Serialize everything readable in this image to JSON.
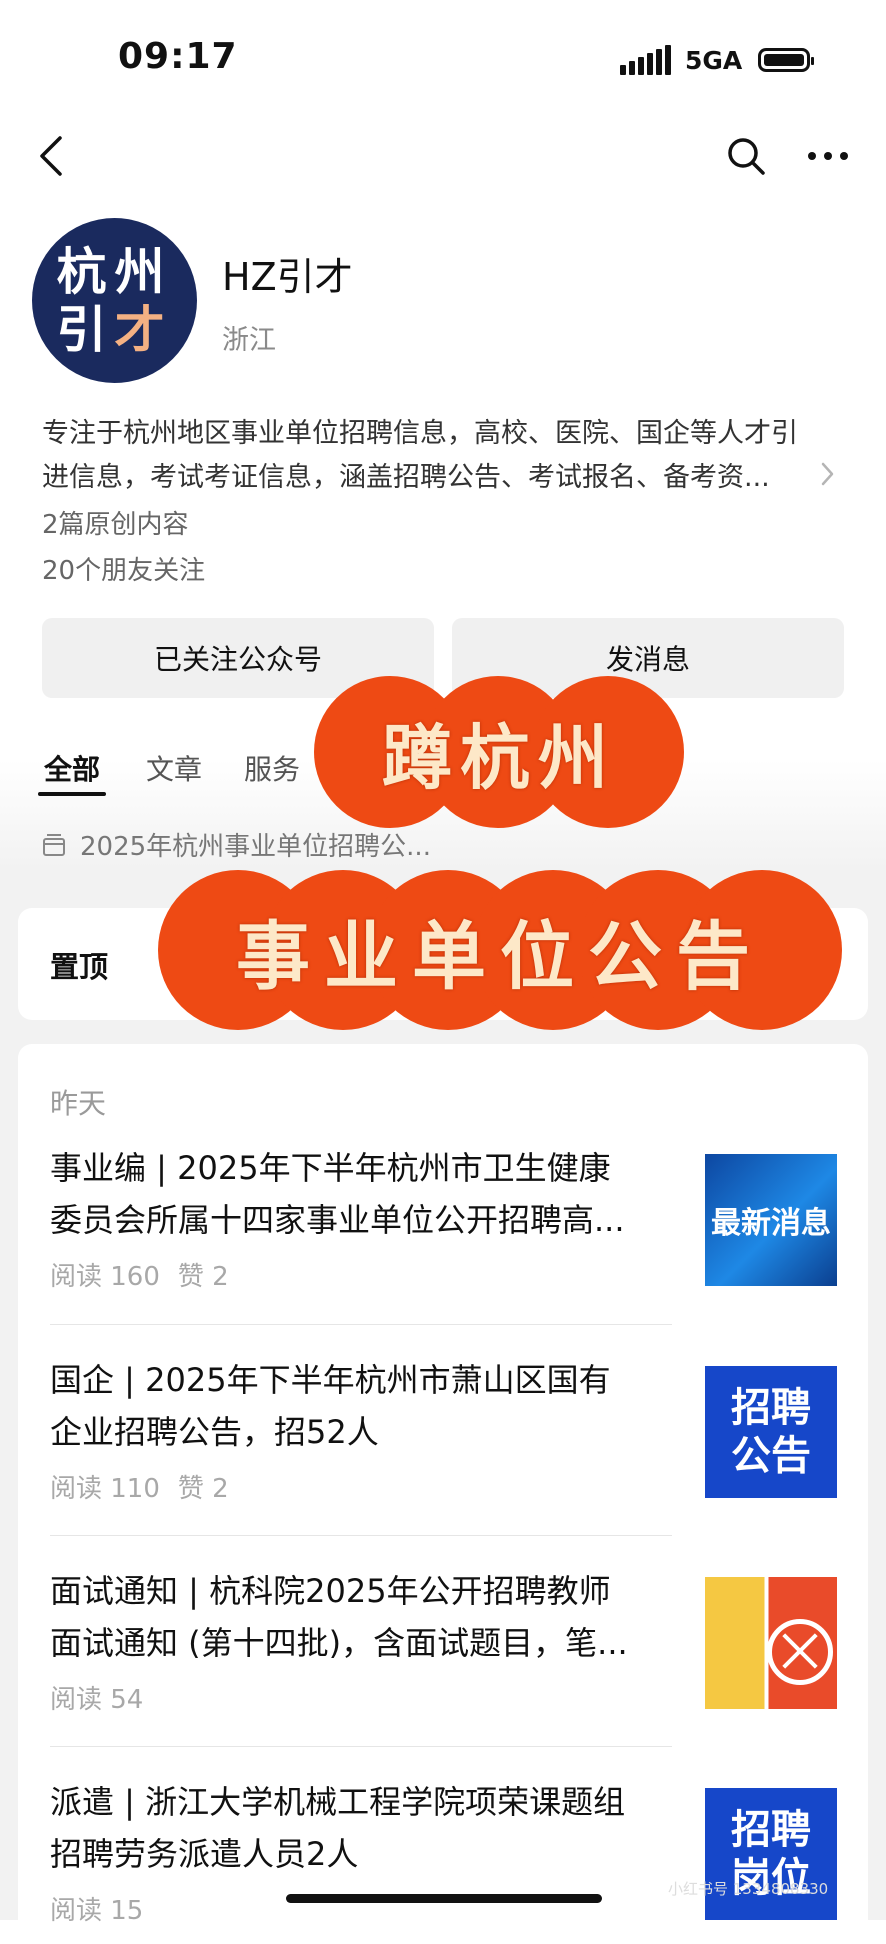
{
  "status_bar": {
    "time": "09:17",
    "network": "5GA"
  },
  "account": {
    "avatar_line1": "杭州",
    "avatar_line2_a": "引",
    "avatar_line2_b": "才",
    "name": "HZ引才",
    "region": "浙江",
    "description_line1": "专注于杭州地区事业单位招聘信息，高校、医院、国企等人才引",
    "description_line2": "进信息，考试考证信息，涵盖招聘公告、考试报名、备考资...",
    "original_count": "2篇原创内容",
    "friends_following": "20个朋友关注"
  },
  "actions": {
    "follow_label": "已关注公众号",
    "message_label": "发消息"
  },
  "tabs": [
    {
      "label": "全部"
    },
    {
      "label": "文章"
    },
    {
      "label": "服务"
    }
  ],
  "collection": {
    "title": "2025年杭州事业单位招聘公..."
  },
  "pinned": {
    "label": "置顶"
  },
  "feed": {
    "date_label": "昨天",
    "articles": [
      {
        "title_line1": "事业编 | 2025年下半年杭州市卫生健康",
        "title_line2": "委员会所属十四家事业单位公开招聘高...",
        "reads": "阅读 160",
        "likes": "赞 2",
        "thumb_text": "最新消息"
      },
      {
        "title_line1": "国企 | 2025年下半年杭州市萧山区国有",
        "title_line2": "企业招聘公告，招52人",
        "reads": "阅读 110",
        "likes": "赞 2",
        "thumb_line1": "招聘",
        "thumb_line2": "公告"
      },
      {
        "title_line1": "面试通知 | 杭科院2025年公开招聘教师",
        "title_line2": "面试通知 (第十四批)，含面试题目，笔...",
        "reads": "阅读 54"
      },
      {
        "title_line1": "派遣 | 浙江大学机械工程学院项荣课题组",
        "title_line2": "招聘劳务派遣人员2人",
        "reads": "阅读 15",
        "thumb_line1": "招聘",
        "thumb_line2": "岗位"
      }
    ]
  },
  "overlay": {
    "banner1": "蹲杭州",
    "banner2": "事业单位公告"
  },
  "watermark": "小红书号 1334808330",
  "colors": {
    "accent_orange": "#ee4a14",
    "avatar_navy": "#1a2a5e",
    "thumb_blue": "#1647c9"
  }
}
